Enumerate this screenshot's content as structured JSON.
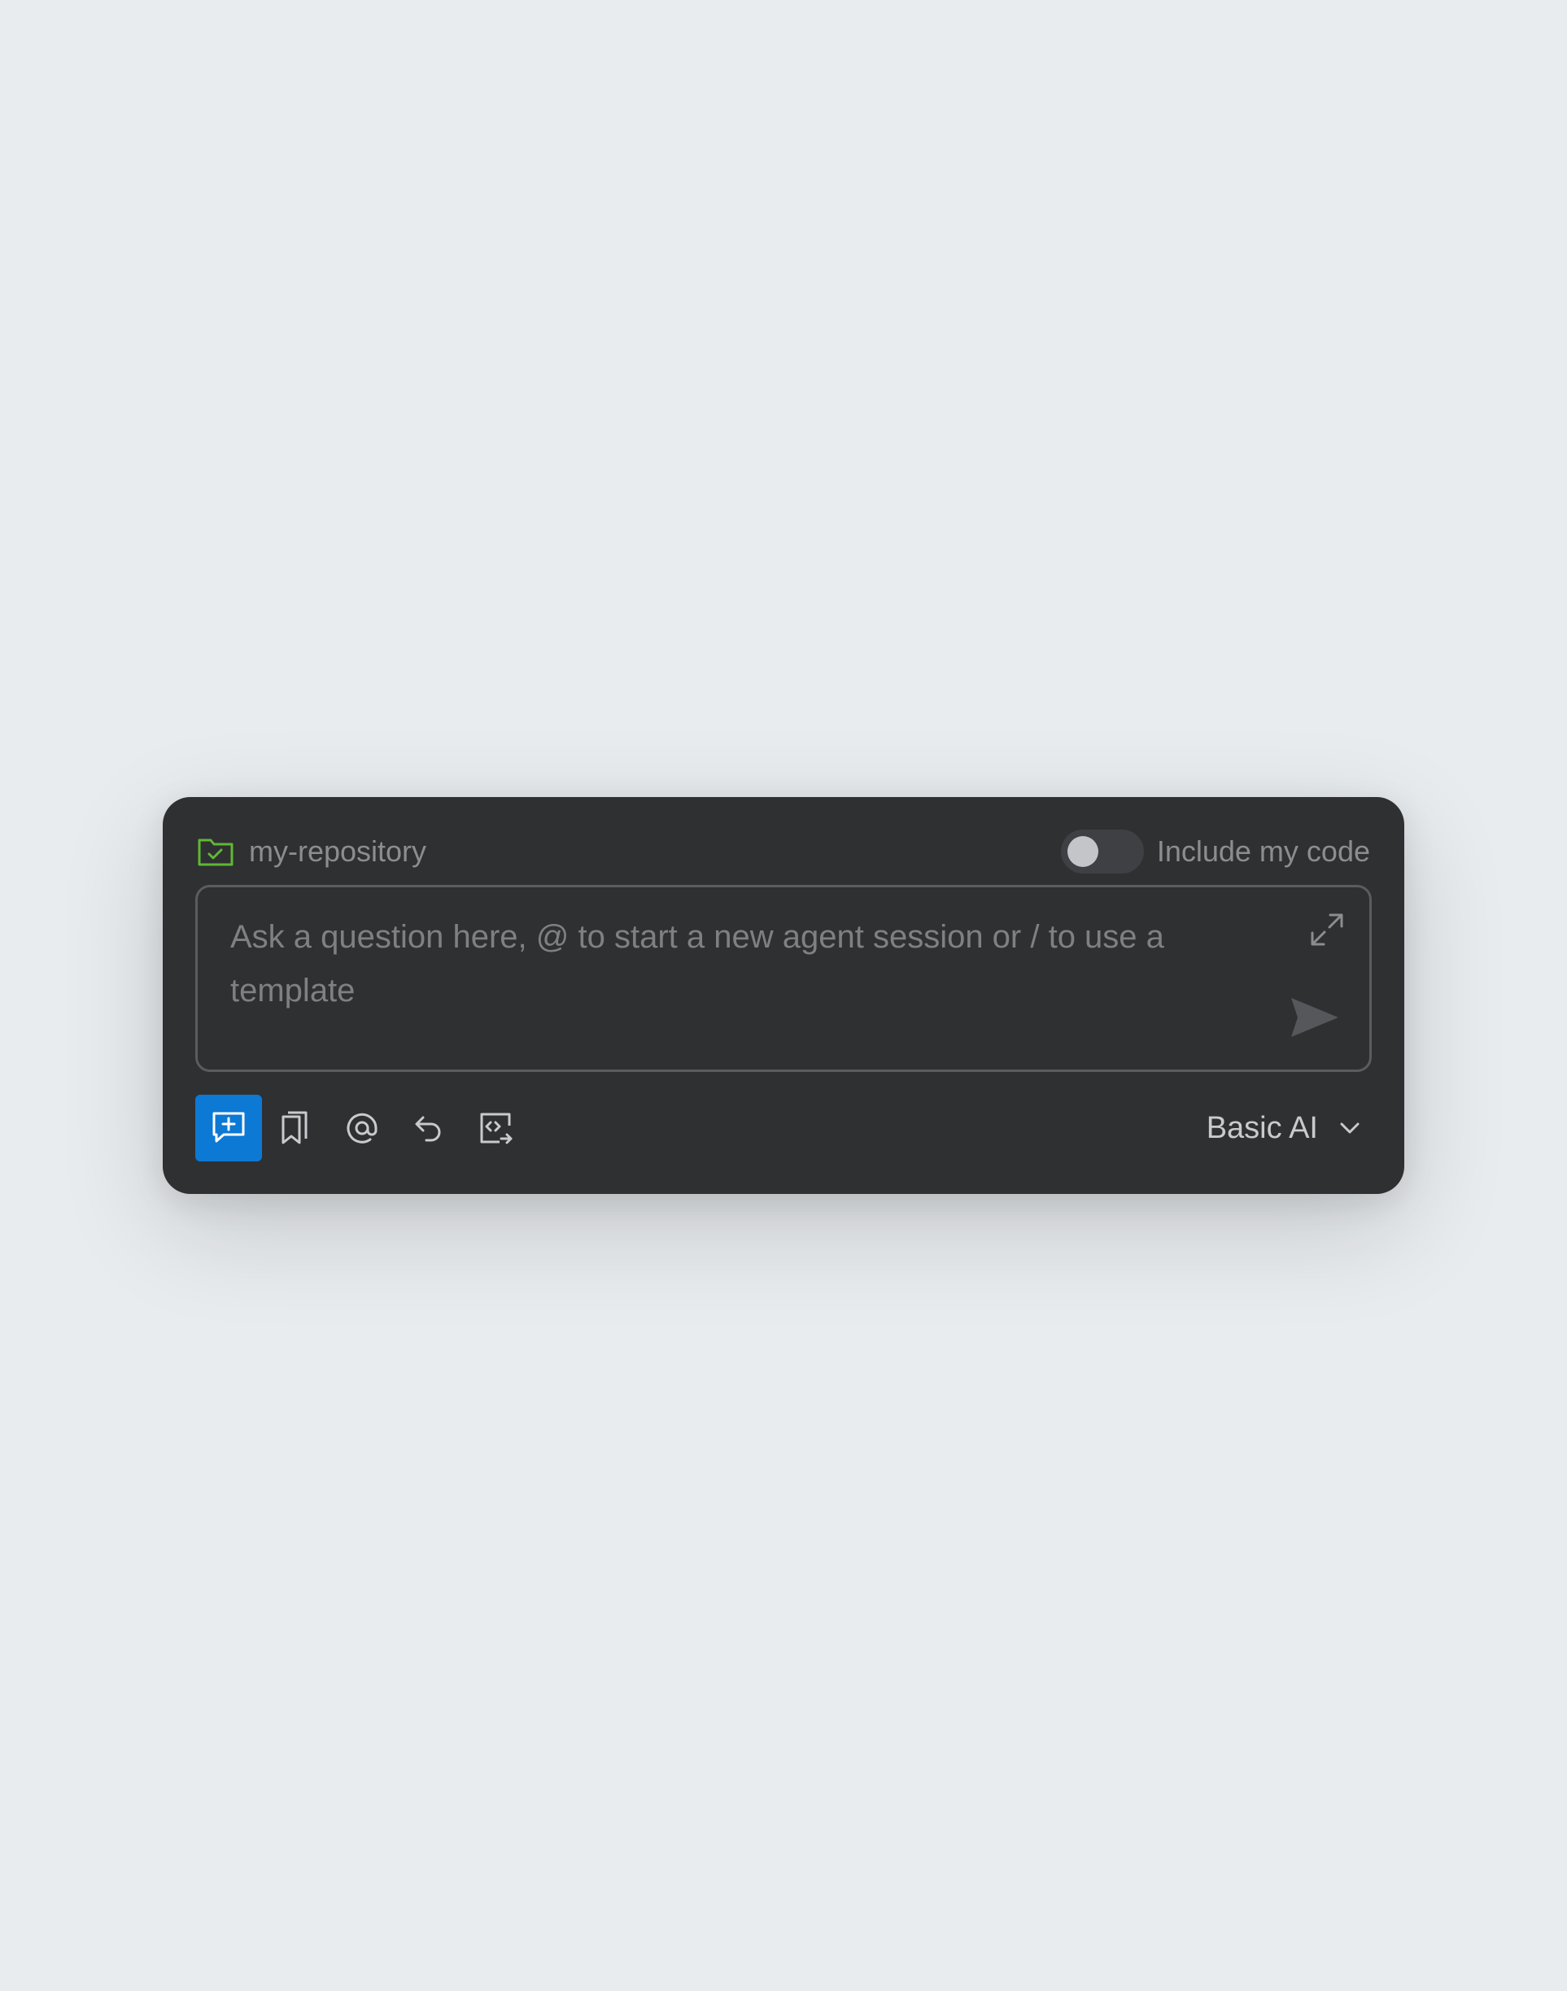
{
  "header": {
    "repository_name": "my-repository",
    "repository_icon": "folder-check-icon",
    "include_code_label": "Include my code",
    "include_code_enabled": false
  },
  "input": {
    "placeholder": "Ask a question here, @ to start a new agent session or / to use a template",
    "value": ""
  },
  "toolbar": {
    "tools": [
      {
        "icon": "new-chat-icon",
        "active": true
      },
      {
        "icon": "bookmarks-icon",
        "active": false
      },
      {
        "icon": "mention-icon",
        "active": false
      },
      {
        "icon": "undo-icon",
        "active": false
      },
      {
        "icon": "code-context-icon",
        "active": false
      }
    ],
    "model_label": "Basic AI"
  },
  "colors": {
    "background": "#e9ecef",
    "panel": "#2f3032",
    "accent": "#0c79d4",
    "repo_icon": "#5fb832",
    "muted_text": "#8b8d91"
  }
}
